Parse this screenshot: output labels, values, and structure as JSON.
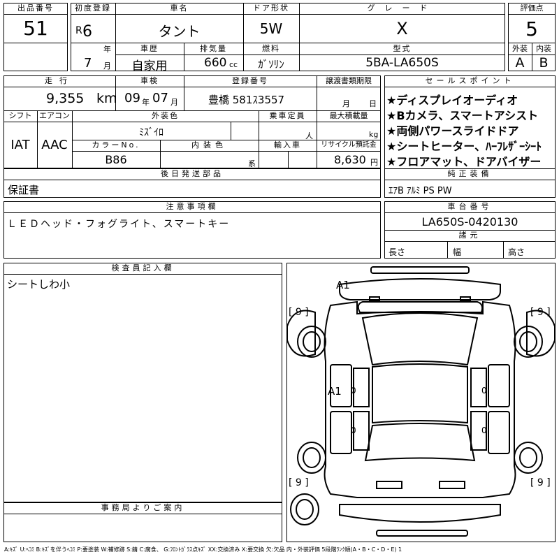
{
  "lot": {
    "label": "出品番号",
    "value": "51"
  },
  "first_reg": {
    "label": "初度登録",
    "era": "R",
    "year": "6",
    "year_unit": "年",
    "month": "7",
    "month_unit": "月"
  },
  "car_name": {
    "label": "車名",
    "value": "タント"
  },
  "door": {
    "label": "ドア形状",
    "value": "5W"
  },
  "grade": {
    "label": "グレード",
    "value": "X"
  },
  "score": {
    "label": "評価点",
    "value": "5",
    "exterior_label": "外装",
    "exterior_value": "A",
    "interior_label": "内装",
    "interior_value": "B"
  },
  "history": {
    "label": "車歴",
    "value": "自家用"
  },
  "displacement": {
    "label": "排気量",
    "value": "660",
    "unit": "cc"
  },
  "fuel": {
    "label": "燃料",
    "value": "ｶﾞｿﾘﾝ"
  },
  "model": {
    "label": "型式",
    "value": "5BA-LA650S"
  },
  "mileage": {
    "label": "走行",
    "value": "9,355",
    "unit": "km"
  },
  "inspection": {
    "label": "車検",
    "year": "09",
    "year_unit": "年",
    "month": "07",
    "month_unit": "月"
  },
  "registration": {
    "label": "登録番号",
    "value": "豊橋 581ｽ3557"
  },
  "transfer_deadline": {
    "label": "譲渡書類期限",
    "month_unit": "月",
    "day_unit": "日"
  },
  "shift": {
    "label": "シフト",
    "value": "IAT"
  },
  "aircon": {
    "label": "エアコン",
    "value": "AAC"
  },
  "exterior_color": {
    "label": "外装色",
    "value": "ﾐｽﾞｲﾛ"
  },
  "capacity": {
    "label": "乗車定員",
    "unit": "人"
  },
  "max_load": {
    "label": "最大積載量",
    "unit": "kg"
  },
  "color_no": {
    "label": "カラーNo.",
    "value": "B86"
  },
  "interior_color": {
    "label": "内装色",
    "unit": "系"
  },
  "import": {
    "label": "輸入車"
  },
  "recycle": {
    "label": "リサイクル預託金",
    "value": "8,630",
    "unit": "円"
  },
  "later_parts": {
    "label": "後日発送部品",
    "value": "保証書"
  },
  "sales_points": {
    "label": "セールスポイント",
    "items": [
      "★ディスプレイオーディオ",
      "★Bカメラ、スマートアシスト",
      "★両側パワースライドドア",
      "★シートヒーター、ﾊｰﾌﾚｻﾞｰｼｰﾄ",
      "★フロアマット、ドアバイザー"
    ]
  },
  "genuine_equipment": {
    "label": "純正装備",
    "value": "ｴｱB ｱﾙﾐ PS PW"
  },
  "notes": {
    "label": "注意事項欄",
    "value": "ＬＥＤヘッド・フォグライト、スマートキー"
  },
  "chassis": {
    "label": "車台番号",
    "value": "LA650S-0420130"
  },
  "specs": {
    "label": "諸元",
    "length_label": "長さ",
    "width_label": "幅",
    "height_label": "高さ"
  },
  "inspector": {
    "label": "検査員記入欄",
    "value": "シートしわ小"
  },
  "office": {
    "label": "事務局よりご案内"
  },
  "diagram": {
    "mark_top": "A1",
    "mark_side": "A1",
    "zero": "0",
    "tire_fl": "[ 9 ]",
    "tire_fr": "[ 9 ]",
    "tire_rl": "[ 9 ]",
    "tire_rr": "[ 9 ]"
  },
  "legend": "A:ｷｽﾞ U:ﾍｺﾐ B:ｷｽﾞを伴うﾍｺﾐ P:要塗装 W:補修跡 S:錆 C:腐食、 G:ﾌﾛﾝﾄｶﾞﾗｽ点ｷｽﾞ XX:交換済み X:要交換 欠:欠品 内・外装評価 5段階ﾗﾝｸ順(A・B・C・D・E) 1"
}
